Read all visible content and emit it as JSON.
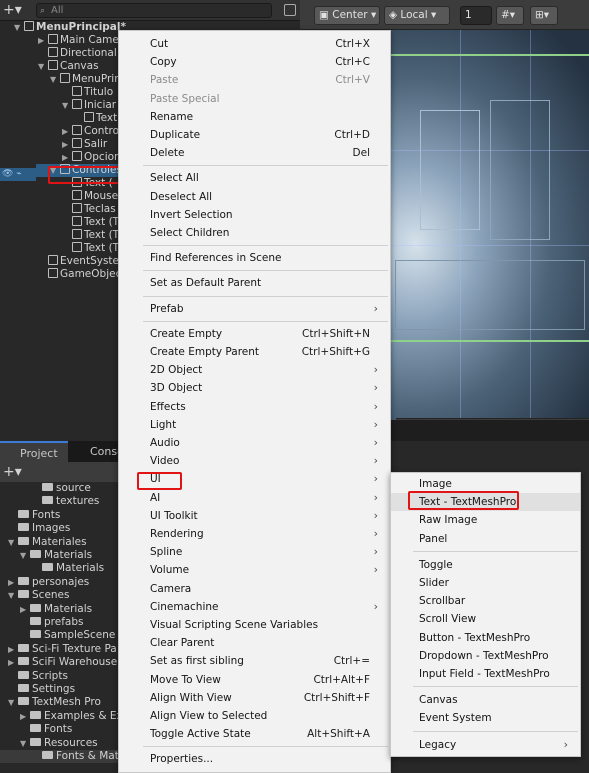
{
  "hierarchy": {
    "search_placeholder": "All",
    "items": [
      {
        "label": "MenuPrincipal*",
        "indent": 0,
        "arrow": "▼",
        "bold": true
      },
      {
        "label": "Main Came",
        "indent": 2,
        "arrow": "▶"
      },
      {
        "label": "Directional",
        "indent": 2,
        "arrow": ""
      },
      {
        "label": "Canvas",
        "indent": 2,
        "arrow": "▼"
      },
      {
        "label": "MenuPrin",
        "indent": 3,
        "arrow": "▼"
      },
      {
        "label": "Titulo",
        "indent": 4,
        "arrow": ""
      },
      {
        "label": "Iniciar",
        "indent": 4,
        "arrow": "▼"
      },
      {
        "label": "Text",
        "indent": 5,
        "arrow": ""
      },
      {
        "label": "Contro",
        "indent": 4,
        "arrow": "▶"
      },
      {
        "label": "Salir",
        "indent": 4,
        "arrow": "▶"
      },
      {
        "label": "Opcion",
        "indent": 4,
        "arrow": "▶"
      },
      {
        "label": "Controles",
        "indent": 3,
        "arrow": "▼",
        "selected": true
      },
      {
        "label": "Text (",
        "indent": 4,
        "arrow": ""
      },
      {
        "label": "Mouse",
        "indent": 4,
        "arrow": ""
      },
      {
        "label": "Teclas",
        "indent": 4,
        "arrow": ""
      },
      {
        "label": "Text (T",
        "indent": 4,
        "arrow": ""
      },
      {
        "label": "Text (T",
        "indent": 4,
        "arrow": ""
      },
      {
        "label": "Text (T",
        "indent": 4,
        "arrow": ""
      },
      {
        "label": "EventSyste",
        "indent": 2,
        "arrow": ""
      },
      {
        "label": "GameObjec",
        "indent": 2,
        "arrow": ""
      }
    ]
  },
  "scene_toolbar": {
    "pivot_label": "Center",
    "space_label": "Local",
    "grid_value": "1"
  },
  "project": {
    "tabs": [
      "Project",
      "Conso"
    ],
    "items": [
      {
        "label": "source",
        "indent": 3,
        "arrow": ""
      },
      {
        "label": "textures",
        "indent": 3,
        "arrow": ""
      },
      {
        "label": "Fonts",
        "indent": 1,
        "arrow": ""
      },
      {
        "label": "Images",
        "indent": 1,
        "arrow": ""
      },
      {
        "label": "Materiales",
        "indent": 1,
        "arrow": "▼"
      },
      {
        "label": "Materials",
        "indent": 2,
        "arrow": "▼"
      },
      {
        "label": "Materials",
        "indent": 3,
        "arrow": ""
      },
      {
        "label": "personajes",
        "indent": 1,
        "arrow": "▶"
      },
      {
        "label": "Scenes",
        "indent": 1,
        "arrow": "▼"
      },
      {
        "label": "Materials",
        "indent": 2,
        "arrow": "▶"
      },
      {
        "label": "prefabs",
        "indent": 2,
        "arrow": ""
      },
      {
        "label": "SampleScene",
        "indent": 2,
        "arrow": ""
      },
      {
        "label": "Sci-Fi Texture Pa",
        "indent": 1,
        "arrow": "▶"
      },
      {
        "label": "SciFi Warehouse",
        "indent": 1,
        "arrow": "▶"
      },
      {
        "label": "Scripts",
        "indent": 1,
        "arrow": ""
      },
      {
        "label": "Settings",
        "indent": 1,
        "arrow": ""
      },
      {
        "label": "TextMesh Pro",
        "indent": 1,
        "arrow": "▼"
      },
      {
        "label": "Examples & Ex",
        "indent": 2,
        "arrow": "▶"
      },
      {
        "label": "Fonts",
        "indent": 2,
        "arrow": ""
      },
      {
        "label": "Resources",
        "indent": 2,
        "arrow": "▼"
      },
      {
        "label": "Fonts & Mat",
        "indent": 3,
        "arrow": ""
      }
    ]
  },
  "context_menu": {
    "items": [
      {
        "label": "Cut",
        "shortcut": "Ctrl+X"
      },
      {
        "label": "Copy",
        "shortcut": "Ctrl+C"
      },
      {
        "label": "Paste",
        "shortcut": "Ctrl+V",
        "disabled": true
      },
      {
        "label": "Paste Special",
        "disabled": true
      },
      {
        "label": "Rename"
      },
      {
        "label": "Duplicate",
        "shortcut": "Ctrl+D"
      },
      {
        "label": "Delete",
        "shortcut": "Del"
      },
      {
        "sep": true
      },
      {
        "label": "Select All"
      },
      {
        "label": "Deselect All"
      },
      {
        "label": "Invert Selection"
      },
      {
        "label": "Select Children"
      },
      {
        "sep": true
      },
      {
        "label": "Find References in Scene"
      },
      {
        "sep": true
      },
      {
        "label": "Set as Default Parent"
      },
      {
        "sep": true
      },
      {
        "label": "Prefab",
        "submenu": true
      },
      {
        "sep": true
      },
      {
        "label": "Create Empty",
        "shortcut": "Ctrl+Shift+N"
      },
      {
        "label": "Create Empty Parent",
        "shortcut": "Ctrl+Shift+G"
      },
      {
        "label": "2D Object",
        "submenu": true
      },
      {
        "label": "3D Object",
        "submenu": true
      },
      {
        "label": "Effects",
        "submenu": true
      },
      {
        "label": "Light",
        "submenu": true
      },
      {
        "label": "Audio",
        "submenu": true
      },
      {
        "label": "Video",
        "submenu": true
      },
      {
        "label": "UI",
        "submenu": true,
        "highlighted": true
      },
      {
        "label": "AI",
        "submenu": true
      },
      {
        "label": "UI Toolkit",
        "submenu": true
      },
      {
        "label": "Rendering",
        "submenu": true
      },
      {
        "label": "Spline",
        "submenu": true
      },
      {
        "label": "Volume",
        "submenu": true
      },
      {
        "label": "Camera"
      },
      {
        "label": "Cinemachine",
        "submenu": true
      },
      {
        "label": "Visual Scripting Scene Variables"
      },
      {
        "label": "Clear Parent"
      },
      {
        "label": "Set as first sibling",
        "shortcut": "Ctrl+="
      },
      {
        "label": "Move To View",
        "shortcut": "Ctrl+Alt+F"
      },
      {
        "label": "Align With View",
        "shortcut": "Ctrl+Shift+F"
      },
      {
        "label": "Align View to Selected"
      },
      {
        "label": "Toggle Active State",
        "shortcut": "Alt+Shift+A"
      },
      {
        "sep": true
      },
      {
        "label": "Properties..."
      }
    ]
  },
  "ui_submenu": {
    "items": [
      {
        "label": "Image"
      },
      {
        "label": "Text - TextMeshPro",
        "hover": true
      },
      {
        "label": "Raw Image"
      },
      {
        "label": "Panel"
      },
      {
        "sep": true
      },
      {
        "label": "Toggle"
      },
      {
        "label": "Slider"
      },
      {
        "label": "Scrollbar"
      },
      {
        "label": "Scroll View"
      },
      {
        "label": "Button - TextMeshPro"
      },
      {
        "label": "Dropdown - TextMeshPro"
      },
      {
        "label": "Input Field - TextMeshPro"
      },
      {
        "sep": true
      },
      {
        "label": "Canvas"
      },
      {
        "label": "Event System"
      },
      {
        "sep": true
      },
      {
        "label": "Legacy",
        "submenu": true
      }
    ]
  },
  "colors": {
    "selection": "#2c5d87",
    "highlight_outline": "#e01414",
    "menu_bg": "#f2f2f2"
  }
}
